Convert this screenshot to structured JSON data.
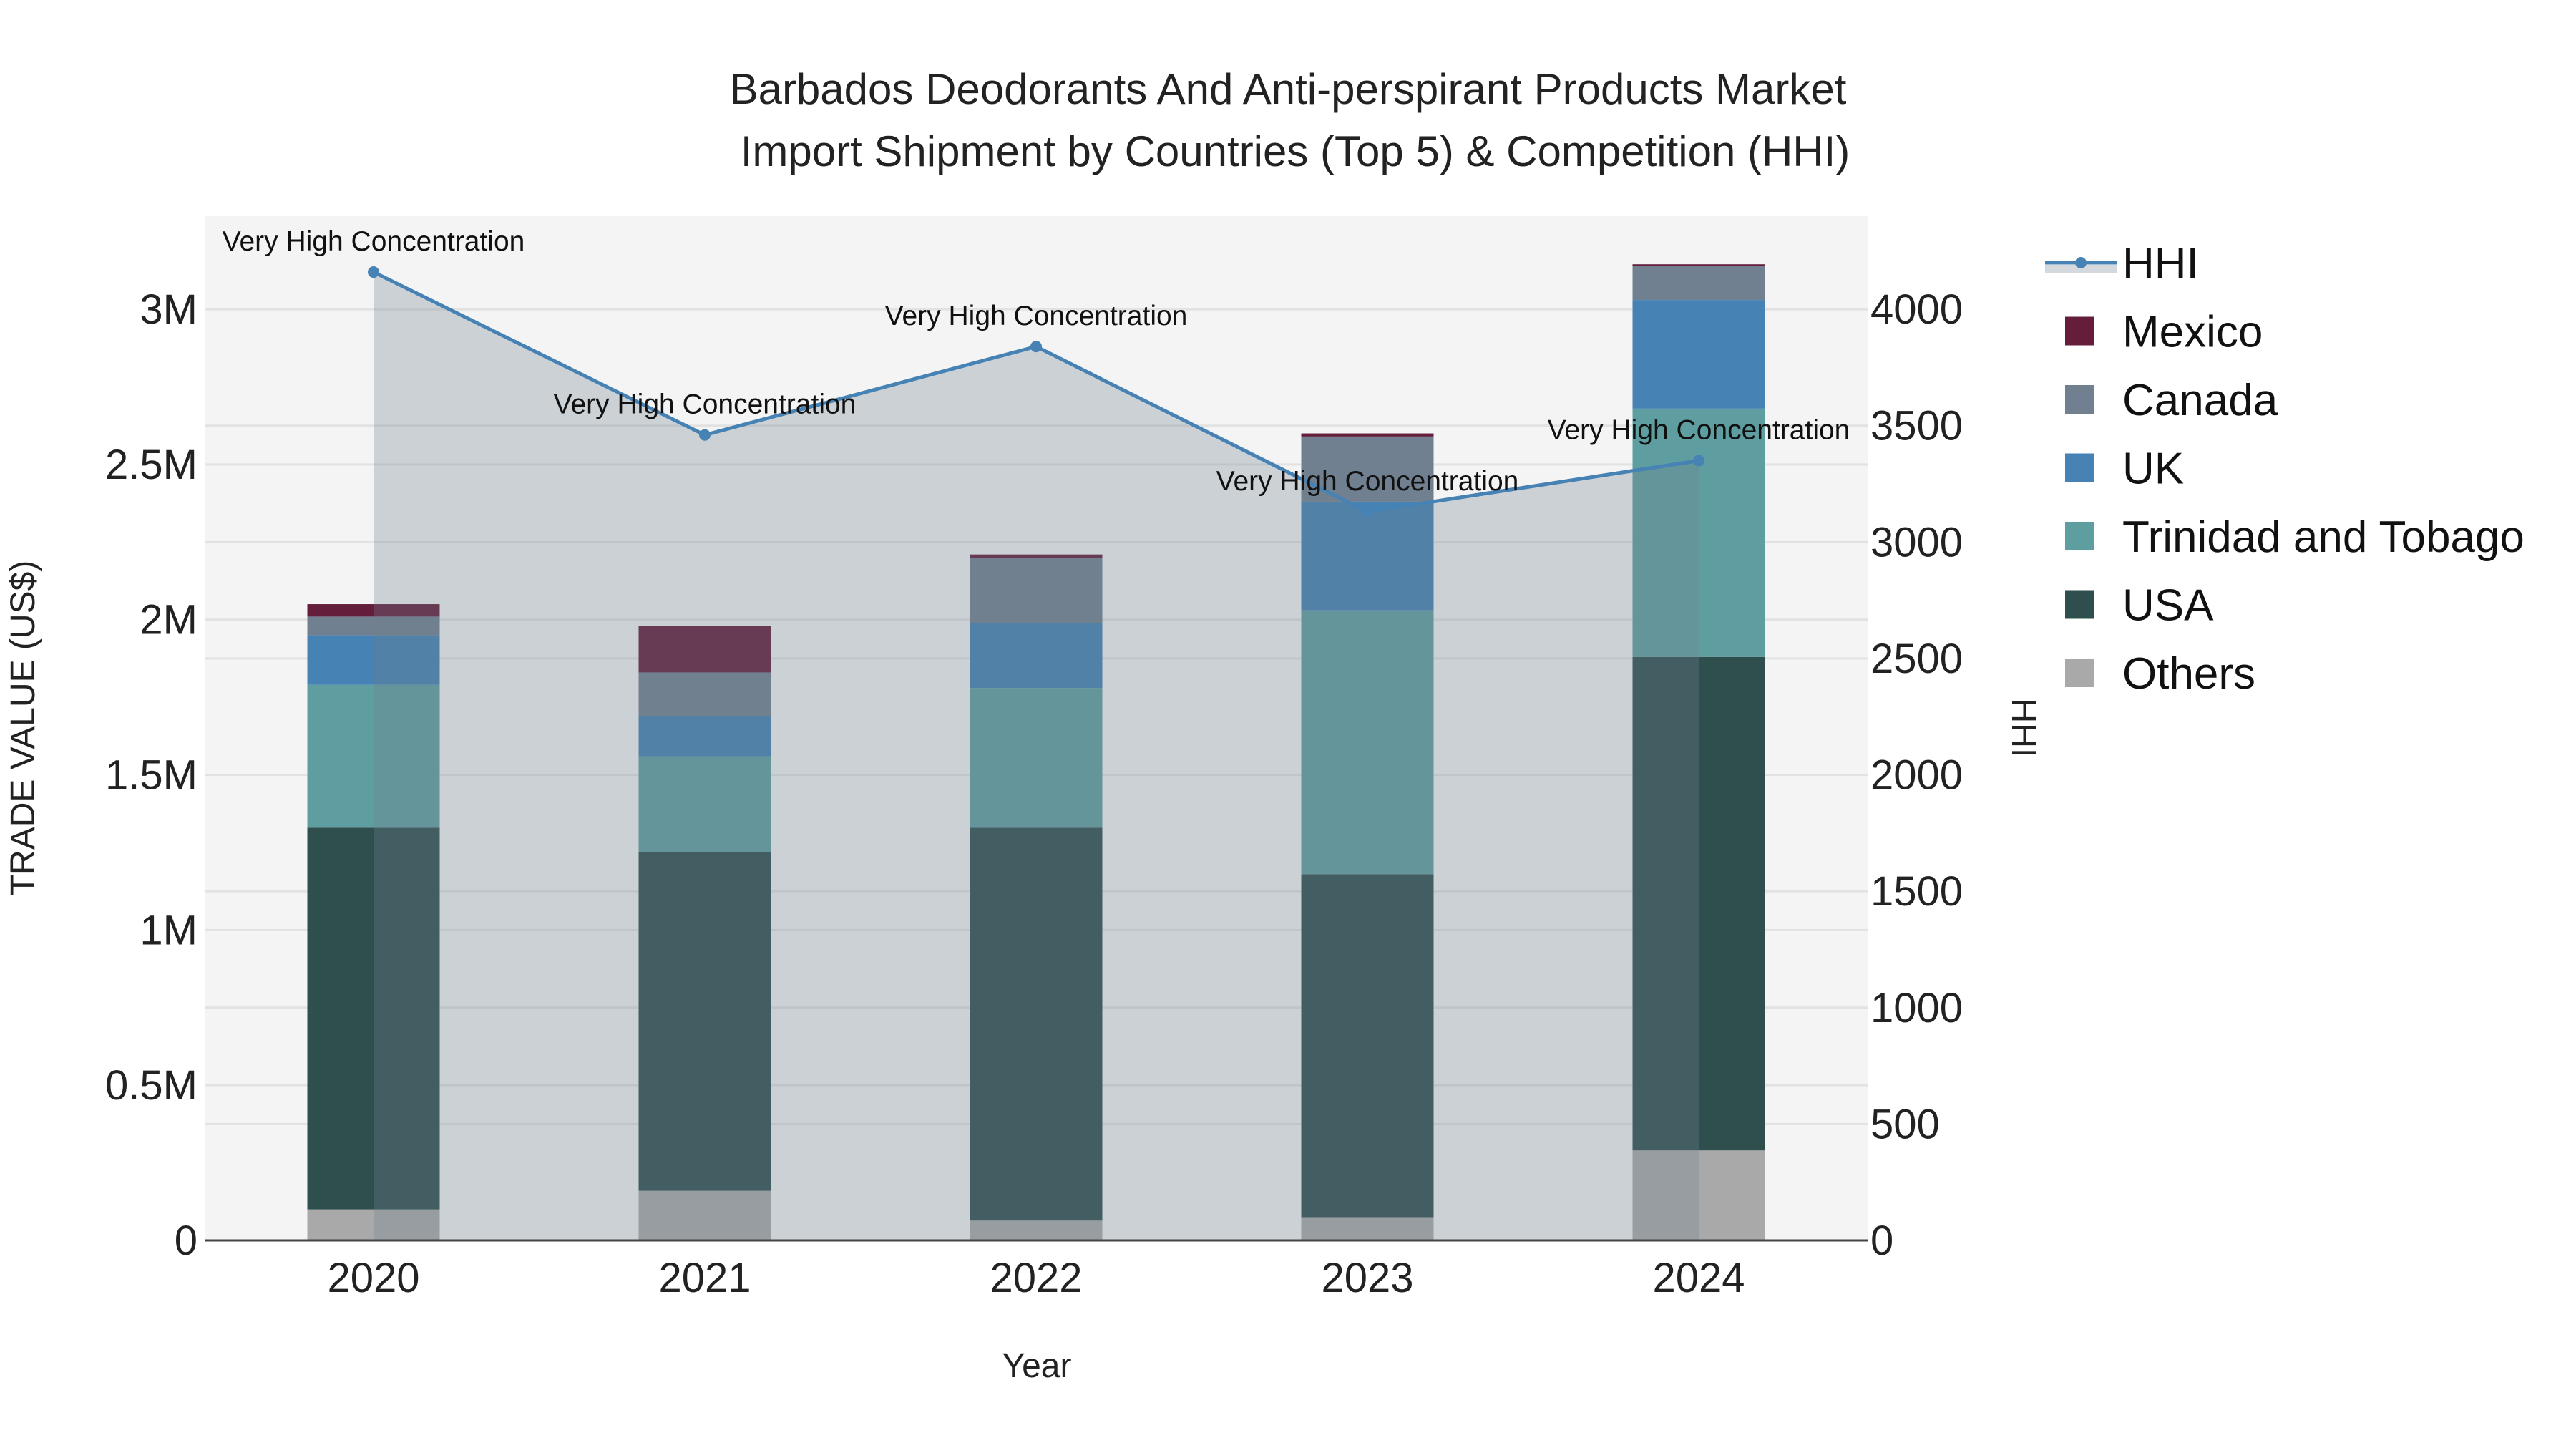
{
  "chart_data": {
    "type": "bar",
    "title_line1": "Barbados Deodorants And Anti-perspirant Products Market",
    "title_line2": "Import Shipment by Countries (Top 5) & Competition (HHI)",
    "xlabel": "Year",
    "ylabel": "TRADE VALUE (US$)",
    "y2label": "HHI",
    "categories": [
      "2020",
      "2021",
      "2022",
      "2023",
      "2024"
    ],
    "ylim": [
      0,
      3300000
    ],
    "y2lim": [
      0,
      4400
    ],
    "yticks": [
      0,
      500000,
      1000000,
      1500000,
      2000000,
      2500000,
      3000000
    ],
    "ytick_labels": [
      "0",
      "0.5M",
      "1M",
      "1.5M",
      "2M",
      "2.5M",
      "3M"
    ],
    "y2ticks": [
      0,
      500,
      1000,
      1500,
      2000,
      2500,
      3000,
      3500,
      4000
    ],
    "y2tick_labels": [
      "0",
      "500",
      "1000",
      "1500",
      "2000",
      "2500",
      "3000",
      "3500",
      "4000"
    ],
    "series": [
      {
        "name": "Others",
        "color": "#A9A9A9",
        "values": [
          100000,
          160000,
          64000,
          75000,
          290000
        ]
      },
      {
        "name": "USA",
        "color": "#2F4F4F",
        "values": [
          1230000,
          1090000,
          1266000,
          1105000,
          1590000
        ]
      },
      {
        "name": "Trinidad and Tobago",
        "color": "#5F9EA0",
        "values": [
          460000,
          310000,
          450000,
          850000,
          800000
        ]
      },
      {
        "name": "UK",
        "color": "#4682B4",
        "values": [
          160000,
          130000,
          210000,
          350000,
          350000
        ]
      },
      {
        "name": "Canada",
        "color": "#708090",
        "values": [
          60000,
          140000,
          210000,
          210000,
          110000
        ]
      },
      {
        "name": "Mexico",
        "color": "#641E3C",
        "values": [
          40000,
          150000,
          10000,
          10000,
          5000
        ]
      }
    ],
    "hhi": {
      "name": "HHI",
      "color": "#4682B4",
      "values": [
        4160,
        3460,
        3840,
        3130,
        3350
      ],
      "annotations": [
        "Very High Concentration",
        "Very High Concentration",
        "Very High Concentration",
        "Very High Concentration",
        "Very High Concentration"
      ]
    },
    "legend": [
      "HHI",
      "Mexico",
      "Canada",
      "UK",
      "Trinidad and Tobago",
      "USA",
      "Others"
    ],
    "legend_placement": "right",
    "grid": true
  }
}
